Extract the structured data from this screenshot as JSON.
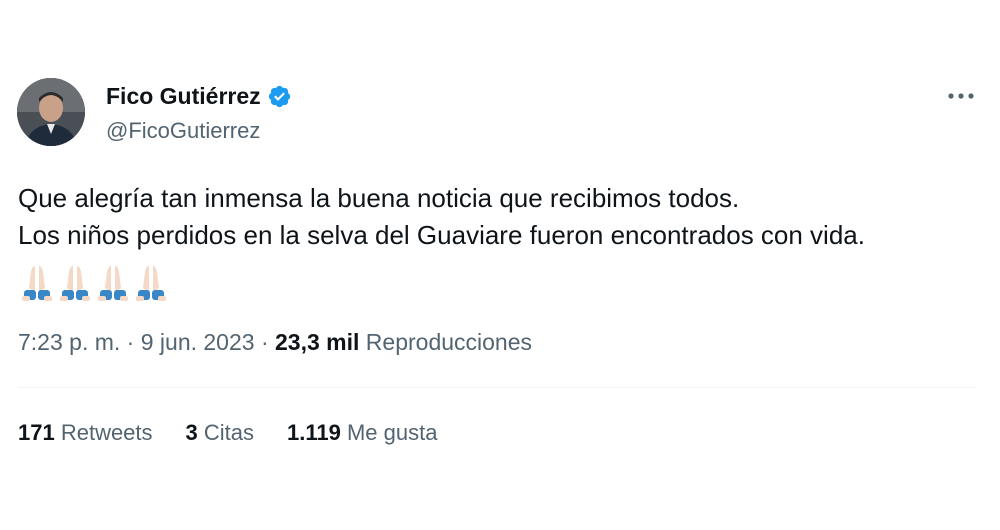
{
  "author": {
    "name": "Fico Gutiérrez",
    "handle": "@FicoGutierrez",
    "verified": true,
    "verified_color": "#1d9bf0"
  },
  "tweet": {
    "lines": [
      "Que alegría tan inmensa la buena noticia que recibimos todos.",
      "Los niños perdidos en la selva del Guaviare fueron encontrados con vida."
    ],
    "emojis": [
      "folded-hands-emoji",
      "folded-hands-emoji",
      "folded-hands-emoji",
      "folded-hands-emoji"
    ]
  },
  "meta": {
    "time": "7:23 p. m.",
    "separator": "·",
    "date": "9 jun. 2023",
    "views_count": "23,3 mil",
    "views_label": "Reproducciones"
  },
  "stats": {
    "retweets_count": "171",
    "retweets_label": "Retweets",
    "quotes_count": "3",
    "quotes_label": "Citas",
    "likes_count": "1.119",
    "likes_label": "Me gusta"
  },
  "icons": {
    "more": "more-horizontal-icon",
    "verified": "verified-badge-icon"
  }
}
